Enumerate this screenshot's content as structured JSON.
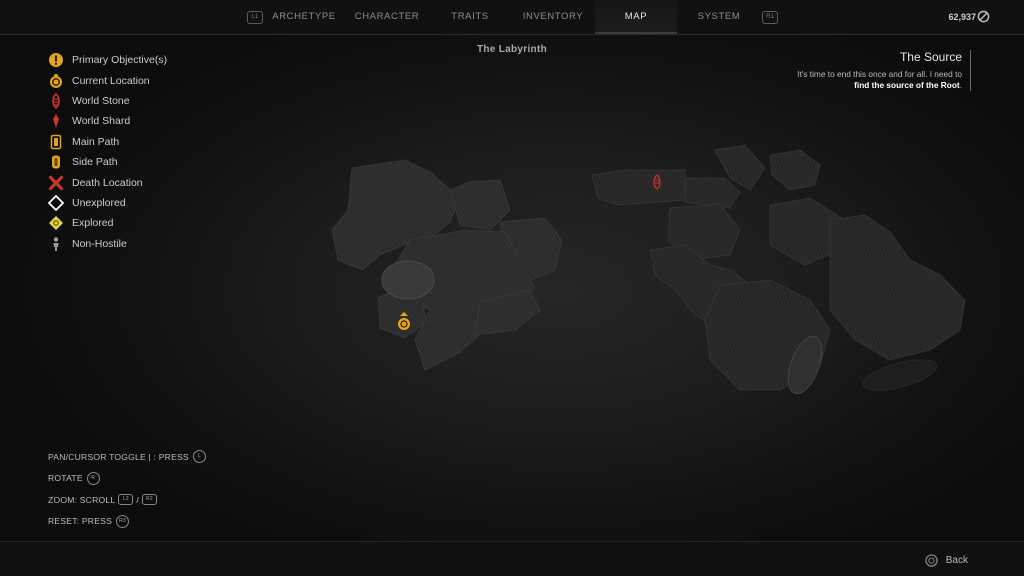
{
  "nav": {
    "left_shoulder": "L1",
    "right_shoulder": "R1",
    "tabs": [
      {
        "label": "ARCHETYPE"
      },
      {
        "label": "CHARACTER"
      },
      {
        "label": "TRAITS"
      },
      {
        "label": "INVENTORY"
      },
      {
        "label": "MAP"
      },
      {
        "label": "SYSTEM"
      }
    ],
    "active_tab": "MAP"
  },
  "currency": {
    "amount": "62,937"
  },
  "map": {
    "title": "The Labyrinth"
  },
  "objective": {
    "title": "The Source",
    "text": "It's time to end this once and for all. I need to",
    "highlight": "find the source of the Root",
    "suffix": "."
  },
  "legend": [
    {
      "label": "Primary Objective(s)",
      "icon": "primary-objective-icon",
      "color": "#e3a51f"
    },
    {
      "label": "Current Location",
      "icon": "current-location-icon",
      "color": "#e3a51f"
    },
    {
      "label": "World Stone",
      "icon": "world-stone-icon",
      "color": "#c8352a"
    },
    {
      "label": "World Shard",
      "icon": "world-shard-icon",
      "color": "#c8352a"
    },
    {
      "label": "Main Path",
      "icon": "main-path-icon",
      "color": "#e3a51f"
    },
    {
      "label": "Side Path",
      "icon": "side-path-icon",
      "color": "#e3a51f"
    },
    {
      "label": "Death Location",
      "icon": "death-location-icon",
      "color": "#c8352a"
    },
    {
      "label": "Unexplored",
      "icon": "unexplored-icon",
      "color": "#ffffff"
    },
    {
      "label": "Explored",
      "icon": "explored-icon",
      "color": "#e0d84a"
    },
    {
      "label": "Non-Hostile",
      "icon": "non-hostile-icon",
      "color": "#9a9a9a"
    }
  ],
  "controls": {
    "pan": {
      "label": "PAN/CURSOR TOGGLE | : PRESS",
      "key": "L"
    },
    "rotate": {
      "label": "ROTATE",
      "key": "R"
    },
    "zoom": {
      "label": "ZOOM: SCROLL",
      "key_a": "L2",
      "sep": "/",
      "key_b": "R2"
    },
    "reset": {
      "label": "RESET: PRESS",
      "key": "R3"
    }
  },
  "back": {
    "label": "Back"
  }
}
